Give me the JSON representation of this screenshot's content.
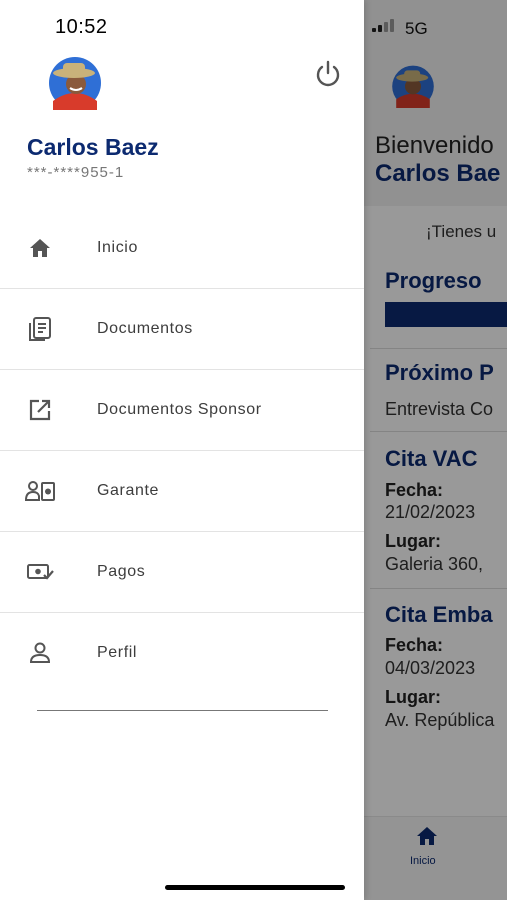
{
  "status_bar": {
    "time": "10:52",
    "network": "5G"
  },
  "drawer": {
    "user": {
      "name": "Carlos Baez",
      "id": "***-****955-1"
    },
    "menu": [
      {
        "label": "Inicio",
        "icon": "home-icon"
      },
      {
        "label": "Documentos",
        "icon": "documents-icon"
      },
      {
        "label": "Documentos Sponsor",
        "icon": "open-external-icon"
      },
      {
        "label": "Garante",
        "icon": "guarantor-icon"
      },
      {
        "label": "Pagos",
        "icon": "payments-icon"
      },
      {
        "label": "Perfil",
        "icon": "profile-icon"
      }
    ]
  },
  "background": {
    "welcome": "Bienvenido",
    "name": "Carlos Bae",
    "question": "¡Tienes u",
    "progress_title": "Progreso",
    "next_title": "Próximo P",
    "next_value": "Entrevista Co",
    "vac_title": "Cita VAC",
    "vac_date_label": "Fecha:",
    "vac_date": "21/02/2023",
    "vac_place_label": "Lugar:",
    "vac_place": "Galeria 360, ",
    "emb_title": "Cita Emba",
    "emb_date_label": "Fecha:",
    "emb_date": "04/03/2023",
    "emb_place_label": "Lugar:",
    "emb_place": "Av. República",
    "tab_home_label": "Inicio"
  },
  "colors": {
    "brand_blue": "#0c2a70",
    "menu_text": "#3d3d3d",
    "overlay": "rgba(0,0,0,0.40)"
  }
}
